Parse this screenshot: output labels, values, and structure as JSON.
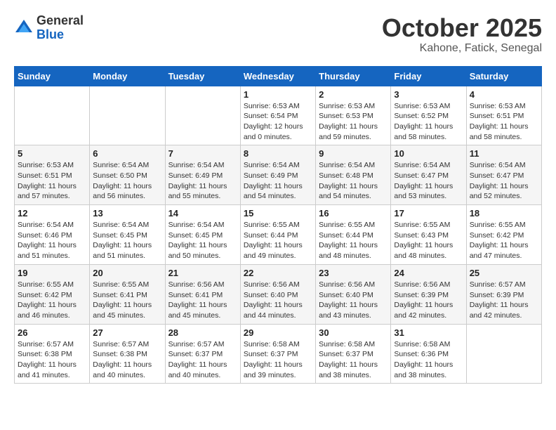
{
  "header": {
    "logo_general": "General",
    "logo_blue": "Blue",
    "title": "October 2025",
    "subtitle": "Kahone, Fatick, Senegal"
  },
  "calendar": {
    "days_of_week": [
      "Sunday",
      "Monday",
      "Tuesday",
      "Wednesday",
      "Thursday",
      "Friday",
      "Saturday"
    ],
    "weeks": [
      {
        "row_index": 0,
        "cells": [
          {
            "day": "",
            "info": ""
          },
          {
            "day": "",
            "info": ""
          },
          {
            "day": "",
            "info": ""
          },
          {
            "day": "1",
            "info": "Sunrise: 6:53 AM\nSunset: 6:54 PM\nDaylight: 12 hours\nand 0 minutes."
          },
          {
            "day": "2",
            "info": "Sunrise: 6:53 AM\nSunset: 6:53 PM\nDaylight: 11 hours\nand 59 minutes."
          },
          {
            "day": "3",
            "info": "Sunrise: 6:53 AM\nSunset: 6:52 PM\nDaylight: 11 hours\nand 58 minutes."
          },
          {
            "day": "4",
            "info": "Sunrise: 6:53 AM\nSunset: 6:51 PM\nDaylight: 11 hours\nand 58 minutes."
          }
        ]
      },
      {
        "row_index": 1,
        "cells": [
          {
            "day": "5",
            "info": "Sunrise: 6:53 AM\nSunset: 6:51 PM\nDaylight: 11 hours\nand 57 minutes."
          },
          {
            "day": "6",
            "info": "Sunrise: 6:54 AM\nSunset: 6:50 PM\nDaylight: 11 hours\nand 56 minutes."
          },
          {
            "day": "7",
            "info": "Sunrise: 6:54 AM\nSunset: 6:49 PM\nDaylight: 11 hours\nand 55 minutes."
          },
          {
            "day": "8",
            "info": "Sunrise: 6:54 AM\nSunset: 6:49 PM\nDaylight: 11 hours\nand 54 minutes."
          },
          {
            "day": "9",
            "info": "Sunrise: 6:54 AM\nSunset: 6:48 PM\nDaylight: 11 hours\nand 54 minutes."
          },
          {
            "day": "10",
            "info": "Sunrise: 6:54 AM\nSunset: 6:47 PM\nDaylight: 11 hours\nand 53 minutes."
          },
          {
            "day": "11",
            "info": "Sunrise: 6:54 AM\nSunset: 6:47 PM\nDaylight: 11 hours\nand 52 minutes."
          }
        ]
      },
      {
        "row_index": 2,
        "cells": [
          {
            "day": "12",
            "info": "Sunrise: 6:54 AM\nSunset: 6:46 PM\nDaylight: 11 hours\nand 51 minutes."
          },
          {
            "day": "13",
            "info": "Sunrise: 6:54 AM\nSunset: 6:45 PM\nDaylight: 11 hours\nand 51 minutes."
          },
          {
            "day": "14",
            "info": "Sunrise: 6:54 AM\nSunset: 6:45 PM\nDaylight: 11 hours\nand 50 minutes."
          },
          {
            "day": "15",
            "info": "Sunrise: 6:55 AM\nSunset: 6:44 PM\nDaylight: 11 hours\nand 49 minutes."
          },
          {
            "day": "16",
            "info": "Sunrise: 6:55 AM\nSunset: 6:44 PM\nDaylight: 11 hours\nand 48 minutes."
          },
          {
            "day": "17",
            "info": "Sunrise: 6:55 AM\nSunset: 6:43 PM\nDaylight: 11 hours\nand 48 minutes."
          },
          {
            "day": "18",
            "info": "Sunrise: 6:55 AM\nSunset: 6:42 PM\nDaylight: 11 hours\nand 47 minutes."
          }
        ]
      },
      {
        "row_index": 3,
        "cells": [
          {
            "day": "19",
            "info": "Sunrise: 6:55 AM\nSunset: 6:42 PM\nDaylight: 11 hours\nand 46 minutes."
          },
          {
            "day": "20",
            "info": "Sunrise: 6:55 AM\nSunset: 6:41 PM\nDaylight: 11 hours\nand 45 minutes."
          },
          {
            "day": "21",
            "info": "Sunrise: 6:56 AM\nSunset: 6:41 PM\nDaylight: 11 hours\nand 45 minutes."
          },
          {
            "day": "22",
            "info": "Sunrise: 6:56 AM\nSunset: 6:40 PM\nDaylight: 11 hours\nand 44 minutes."
          },
          {
            "day": "23",
            "info": "Sunrise: 6:56 AM\nSunset: 6:40 PM\nDaylight: 11 hours\nand 43 minutes."
          },
          {
            "day": "24",
            "info": "Sunrise: 6:56 AM\nSunset: 6:39 PM\nDaylight: 11 hours\nand 42 minutes."
          },
          {
            "day": "25",
            "info": "Sunrise: 6:57 AM\nSunset: 6:39 PM\nDaylight: 11 hours\nand 42 minutes."
          }
        ]
      },
      {
        "row_index": 4,
        "cells": [
          {
            "day": "26",
            "info": "Sunrise: 6:57 AM\nSunset: 6:38 PM\nDaylight: 11 hours\nand 41 minutes."
          },
          {
            "day": "27",
            "info": "Sunrise: 6:57 AM\nSunset: 6:38 PM\nDaylight: 11 hours\nand 40 minutes."
          },
          {
            "day": "28",
            "info": "Sunrise: 6:57 AM\nSunset: 6:37 PM\nDaylight: 11 hours\nand 40 minutes."
          },
          {
            "day": "29",
            "info": "Sunrise: 6:58 AM\nSunset: 6:37 PM\nDaylight: 11 hours\nand 39 minutes."
          },
          {
            "day": "30",
            "info": "Sunrise: 6:58 AM\nSunset: 6:37 PM\nDaylight: 11 hours\nand 38 minutes."
          },
          {
            "day": "31",
            "info": "Sunrise: 6:58 AM\nSunset: 6:36 PM\nDaylight: 11 hours\nand 38 minutes."
          },
          {
            "day": "",
            "info": ""
          }
        ]
      }
    ]
  }
}
